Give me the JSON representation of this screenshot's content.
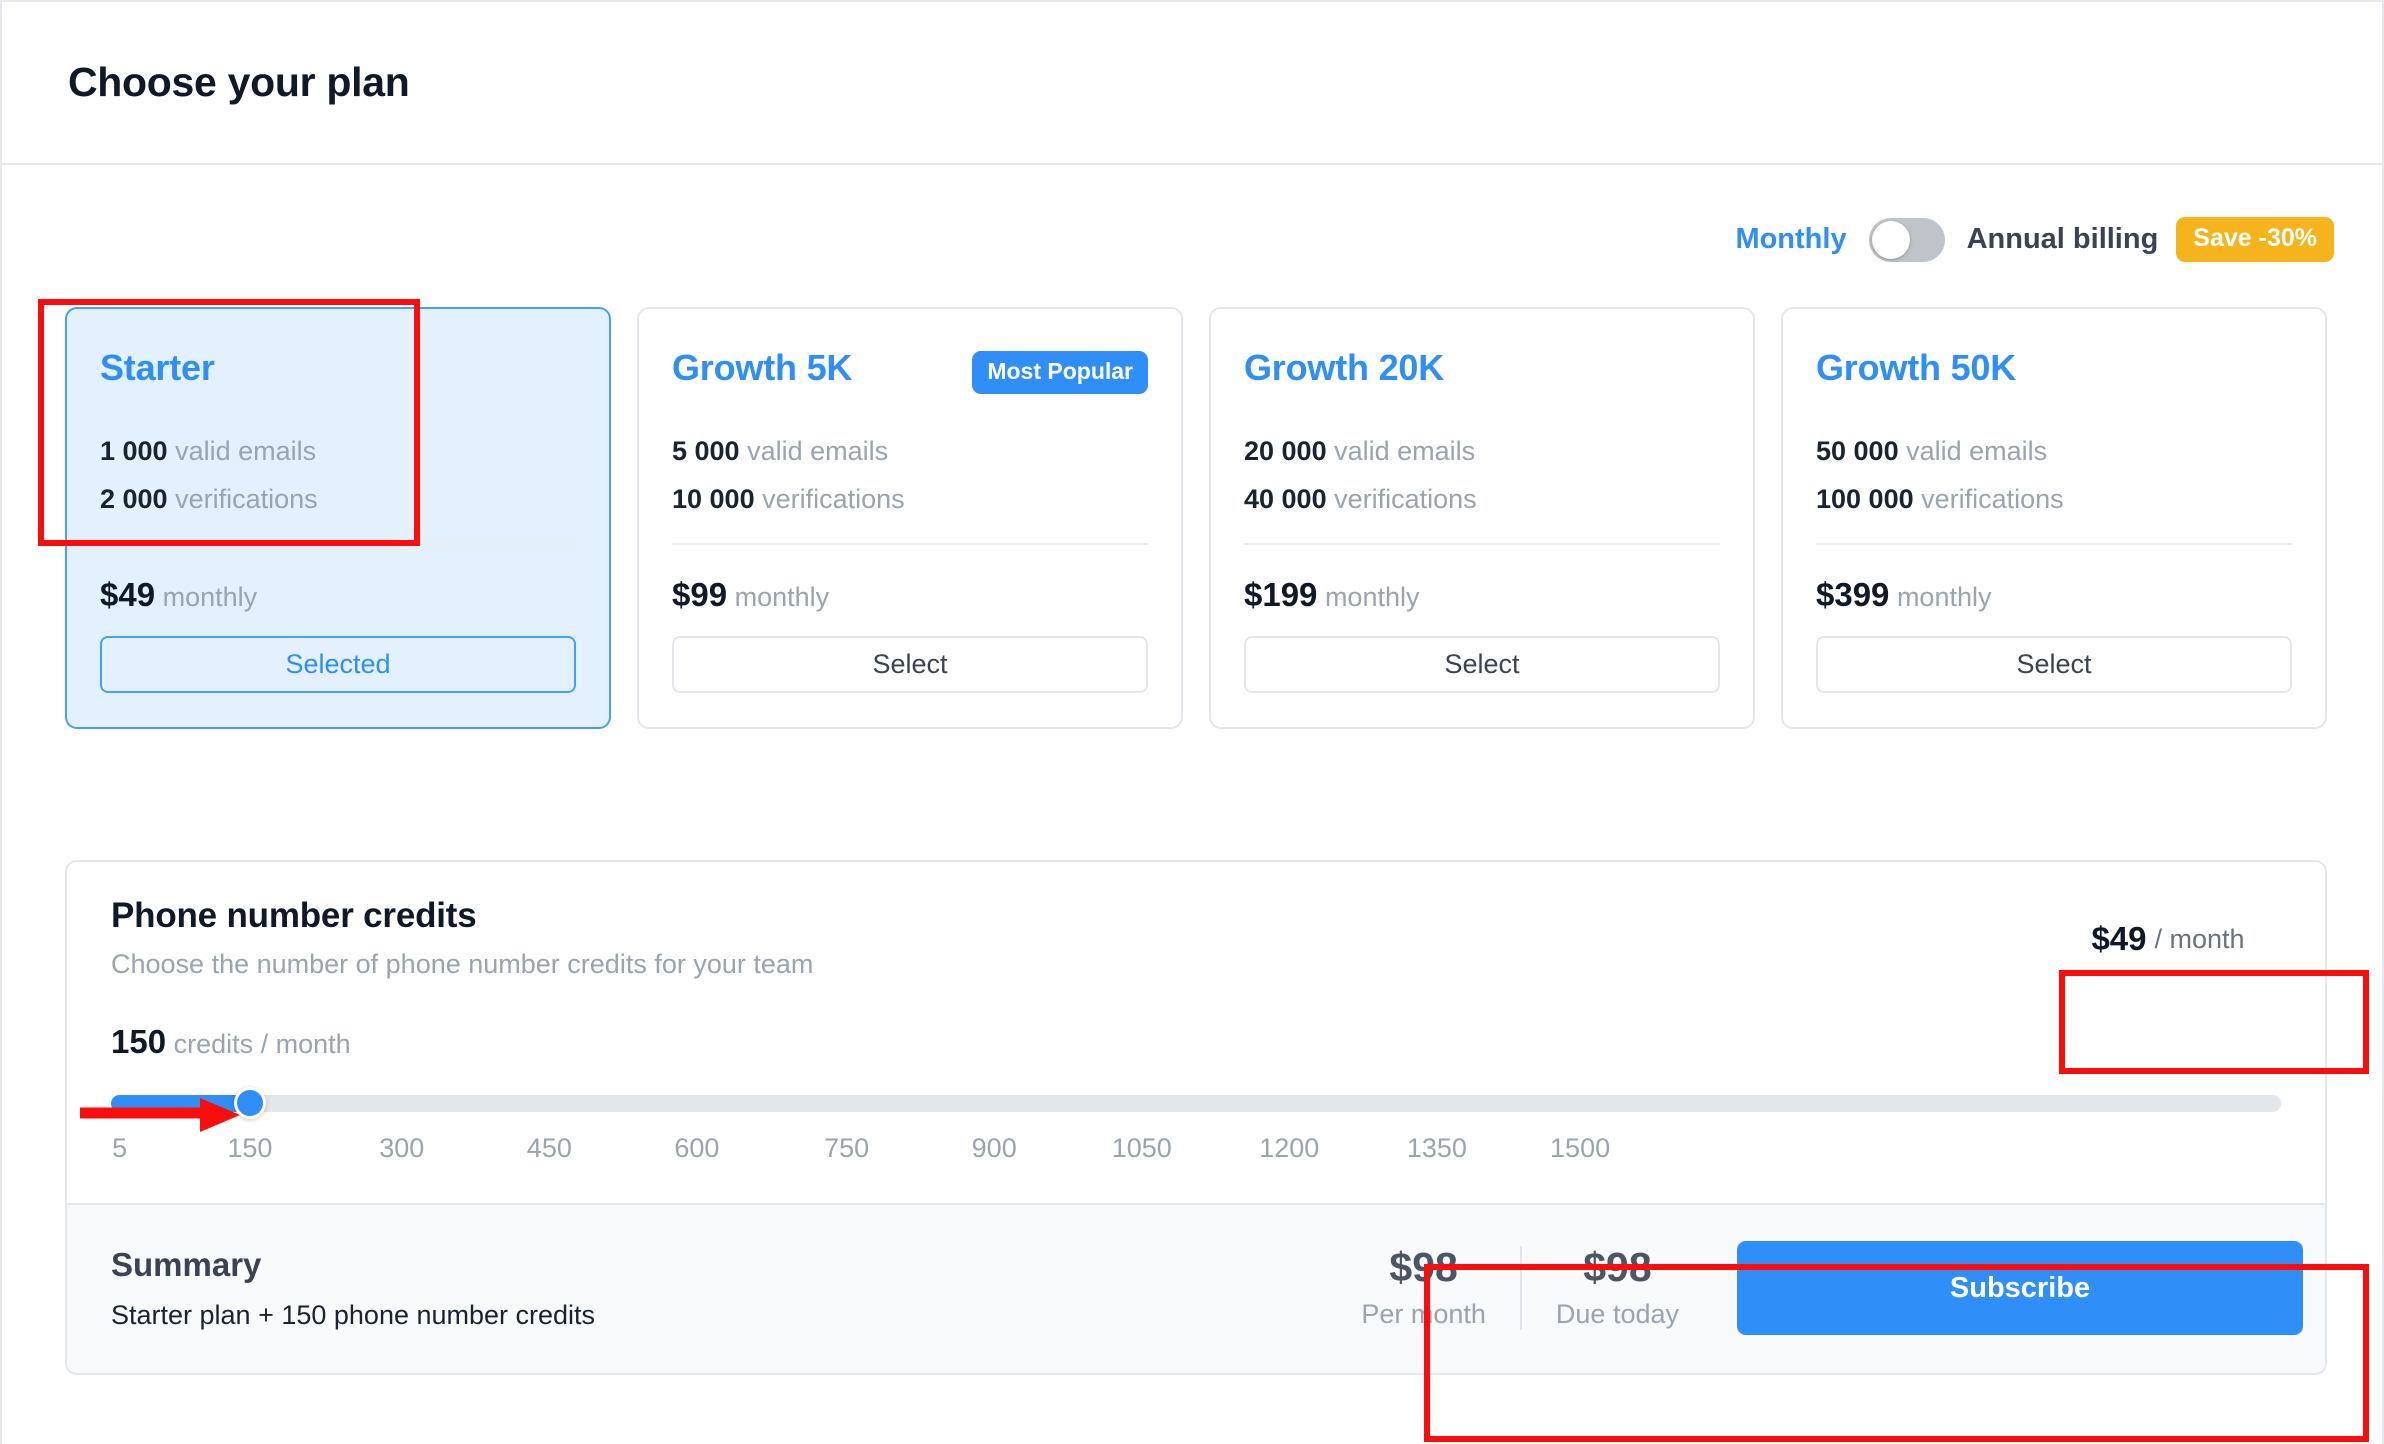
{
  "header": {
    "title": "Choose your plan"
  },
  "billing": {
    "monthly_label": "Monthly",
    "annual_label": "Annual billing",
    "save_badge": "Save -30%",
    "toggle_state": "monthly",
    "accent_color": "#2f8ef7",
    "badge_color": "#f5b41b"
  },
  "plans": [
    {
      "name": "Starter",
      "emails_value": "1 000",
      "emails_label": "valid emails",
      "verifications_value": "2 000",
      "verifications_label": "verifications",
      "price": "$49",
      "period": "monthly",
      "button_label": "Selected",
      "selected": true,
      "badge": ""
    },
    {
      "name": "Growth 5K",
      "emails_value": "5 000",
      "emails_label": "valid emails",
      "verifications_value": "10 000",
      "verifications_label": "verifications",
      "price": "$99",
      "period": "monthly",
      "button_label": "Select",
      "selected": false,
      "badge": "Most Popular"
    },
    {
      "name": "Growth 20K",
      "emails_value": "20 000",
      "emails_label": "valid emails",
      "verifications_value": "40 000",
      "verifications_label": "verifications",
      "price": "$199",
      "period": "monthly",
      "button_label": "Select",
      "selected": false,
      "badge": ""
    },
    {
      "name": "Growth 50K",
      "emails_value": "50 000",
      "emails_label": "valid emails",
      "verifications_value": "100 000",
      "verifications_label": "verifications",
      "price": "$399",
      "period": "monthly",
      "button_label": "Select",
      "selected": false,
      "badge": ""
    }
  ],
  "credits": {
    "title": "Phone number credits",
    "subtitle": "Choose the number of phone number credits for your team",
    "value": "150",
    "value_label": "credits / month",
    "price": "$49",
    "price_label": "/ month",
    "slider": {
      "min": 5,
      "max": 1500,
      "current": 150,
      "ticks": [
        "5",
        "150",
        "300",
        "450",
        "600",
        "750",
        "900",
        "1050",
        "1200",
        "1350",
        "1500"
      ]
    }
  },
  "summary": {
    "title": "Summary",
    "description": "Starter plan + 150 phone number credits",
    "per_month_amount": "$98",
    "per_month_label": "Per month",
    "due_today_amount": "$98",
    "due_today_label": "Due today",
    "subscribe_label": "Subscribe"
  }
}
